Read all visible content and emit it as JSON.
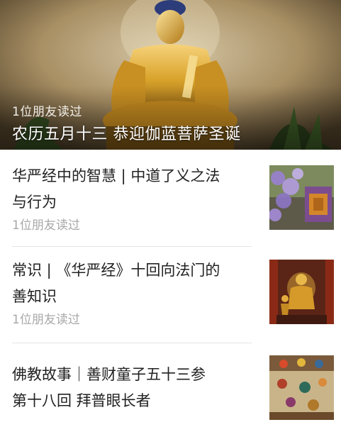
{
  "hero": {
    "friends_read": "1位朋友读过",
    "title": "农历五月十三 恭迎伽蓝菩萨圣诞"
  },
  "articles": [
    {
      "title_line1": "华严经中的智慧 | 中道了义之法",
      "title_line2": "与行为",
      "friends_read": "1位朋友读过",
      "thumb_icon": "wisteria-thumbnail"
    },
    {
      "title_line1": "常识 | 《华严经》十回向法门的",
      "title_line2": "善知识",
      "friends_read": "1位朋友读过",
      "thumb_icon": "buddha-hall-thumbnail"
    },
    {
      "title_line1": "佛教故事｜善财童子五十三参",
      "title_line2": "第十八回 拜普眼长者",
      "thumb_icon": "painting-thumbnail"
    }
  ],
  "colors": {
    "title_text": "#222222",
    "meta_text": "#a8a8a8",
    "divider": "#e5e5e5",
    "gold": "#d9a32b"
  }
}
